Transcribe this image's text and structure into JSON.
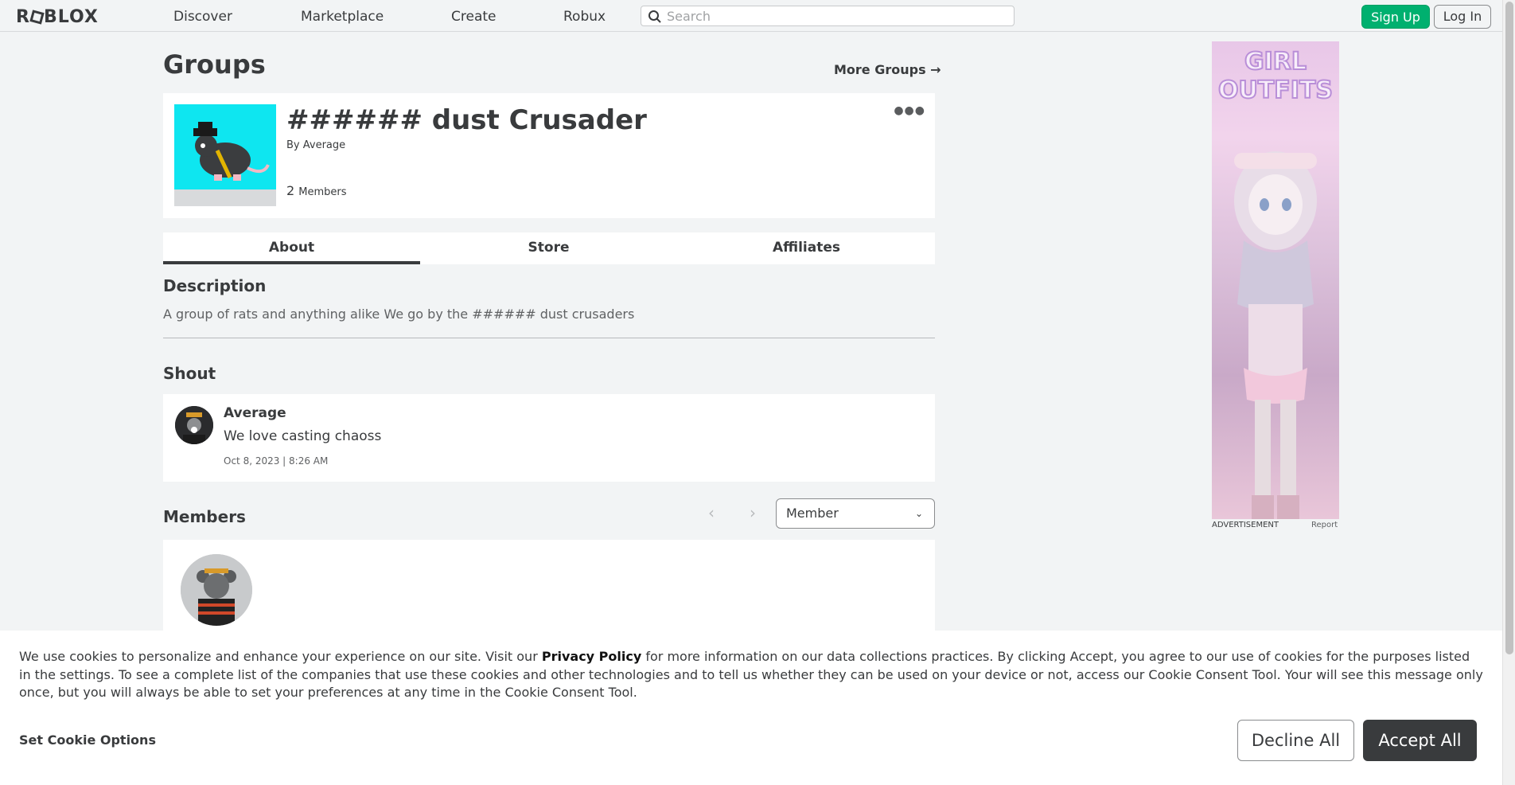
{
  "nav": {
    "logo": "ROBLOX",
    "links": [
      "Discover",
      "Marketplace",
      "Create",
      "Robux"
    ],
    "search_placeholder": "Search",
    "signup": "Sign Up",
    "login": "Log In"
  },
  "page": {
    "title": "Groups",
    "more_groups": "More Groups →"
  },
  "group": {
    "name": "###### dust Crusader",
    "by_label": "By",
    "owner": "Average",
    "member_count": "2",
    "members_label": "Members",
    "menu_icon": "more-dots-icon"
  },
  "tabs": [
    "About",
    "Store",
    "Affiliates"
  ],
  "about": {
    "description_heading": "Description",
    "description": "A group of rats and anything alike We go by the ###### dust crusaders"
  },
  "shout": {
    "heading": "Shout",
    "user": "Average",
    "message": "We love casting chaoss",
    "date": "Oct 8, 2023 | 8:26 AM"
  },
  "members": {
    "heading": "Members",
    "role_selected": "Member"
  },
  "ad": {
    "headline_line1": "GIRL",
    "headline_line2": "OUTFITS",
    "label": "ADVERTISEMENT",
    "report": "Report"
  },
  "cookie": {
    "text_before": "We use cookies to personalize and enhance your experience on our site. Visit our ",
    "privacy_link": "Privacy Policy",
    "text_after": " for more information on our data collections practices. By clicking Accept, you agree to our use of cookies for the purposes listed in the settings. To see a complete list of the companies that use these cookies and other technologies and to tell us whether they can be used on your device or not, access our Cookie Consent Tool. Your will see this message only once, but you will always be able to set your preferences at any time in the Cookie Consent Tool.",
    "options": "Set Cookie Options",
    "decline": "Decline All",
    "accept": "Accept All"
  },
  "colors": {
    "signup_green": "#00b06f",
    "emblem_cyan": "#0ee6f0",
    "accept_dark": "#393b3d"
  }
}
